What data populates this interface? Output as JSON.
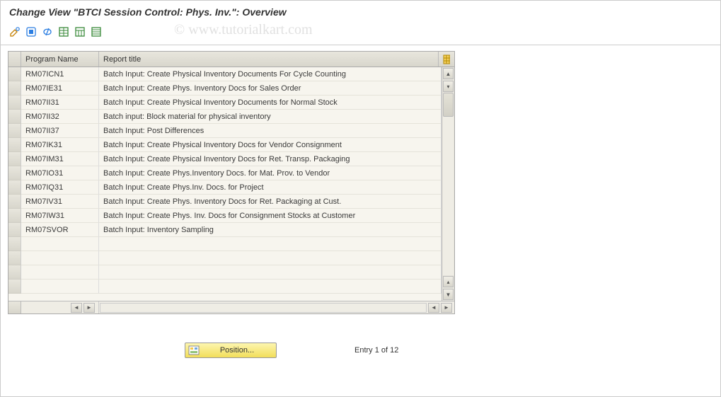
{
  "page_title": "Change View \"BTCI Session Control: Phys. Inv.\": Overview",
  "watermark": "© www.tutorialkart.com",
  "table": {
    "columns": {
      "program": "Program Name",
      "title": "Report title"
    },
    "rows": [
      {
        "program": "RM07ICN1",
        "title": "Batch Input: Create Physical Inventory Documents For Cycle Counting"
      },
      {
        "program": "RM07IE31",
        "title": "Batch Input: Create Phys. Inventory Docs for Sales Order"
      },
      {
        "program": "RM07II31",
        "title": "Batch Input: Create Physical Inventory Documents for Normal Stock"
      },
      {
        "program": "RM07II32",
        "title": "Batch input: Block material for physical inventory"
      },
      {
        "program": "RM07II37",
        "title": "Batch Input: Post Differences"
      },
      {
        "program": "RM07IK31",
        "title": "Batch Input: Create Physical Inventory Docs for Vendor Consignment"
      },
      {
        "program": "RM07IM31",
        "title": "Batch Input: Create Physical Inventory Docs for Ret. Transp. Packaging"
      },
      {
        "program": "RM07IO31",
        "title": "Batch Input: Create Phys.Inventory Docs. for Mat. Prov. to Vendor"
      },
      {
        "program": "RM07IQ31",
        "title": "Batch Input: Create Phys.Inv. Docs. for Project"
      },
      {
        "program": "RM07IV31",
        "title": "Batch Input: Create Phys. Inventory Docs for Ret. Packaging at Cust."
      },
      {
        "program": "RM07IW31",
        "title": "Batch Input: Create Phys. Inv. Docs for Consignment Stocks at Customer"
      },
      {
        "program": "RM07SVOR",
        "title": "Batch Input: Inventory Sampling"
      }
    ]
  },
  "footer": {
    "position_button": "Position...",
    "entry_text": "Entry 1 of 12"
  }
}
